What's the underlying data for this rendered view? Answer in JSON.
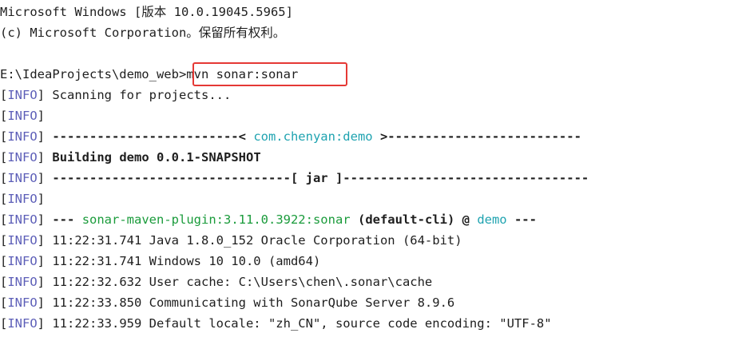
{
  "header": {
    "line1": "Microsoft Windows [版本 10.0.19045.5965]",
    "line2": "(c) Microsoft Corporation。保留所有权利。"
  },
  "prompt": {
    "path": "E:\\IdeaProjects\\demo_web>",
    "command": "mvn sonar:sonar"
  },
  "log": {
    "lb": "[",
    "level": "INFO",
    "rb": "]",
    "scanning": " Scanning for projects...",
    "sep1_left": " -------------------------< ",
    "artifact": "com.chenyan:demo",
    "sep1_right": " >--------------------------",
    "building": "Building demo 0.0.1-SNAPSHOT",
    "sep2": "--------------------------------[ jar ]---------------------------------",
    "goal_prefix": " --- ",
    "plugin": "sonar-maven-plugin:3.11.0.3922:sonar",
    "execution": "(default-cli)",
    "at": " @ ",
    "project": "demo",
    "goal_suffix": " ---",
    "java": " 11:22:31.741 Java 1.8.0_152 Oracle Corporation (64-bit)",
    "os": " 11:22:31.741 Windows 10 10.0 (amd64)",
    "cache": " 11:22:32.632 User cache: C:\\Users\\chen\\.sonar\\cache",
    "server": " 11:22:33.850 Communicating with SonarQube Server 8.9.6",
    "locale": " 11:22:33.959 Default locale: \"zh_CN\", source code encoding: \"UTF-8\""
  },
  "colors": {
    "info": "#5d5fb8",
    "cyan": "#1fa3b0",
    "green": "#1a9b3b",
    "highlight_border": "#e53935"
  }
}
